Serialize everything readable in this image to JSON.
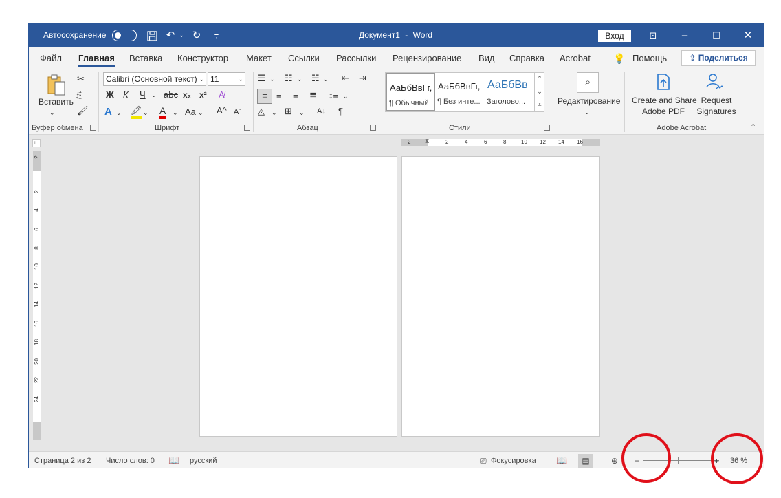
{
  "titlebar": {
    "autosave_label": "Автосохранение",
    "doc_title": "Документ1",
    "separator": "-",
    "app_name": "Word",
    "signin_label": "Вход"
  },
  "tabs": [
    {
      "label": "Файл"
    },
    {
      "label": "Главная"
    },
    {
      "label": "Вставка"
    },
    {
      "label": "Конструктор"
    },
    {
      "label": "Макет"
    },
    {
      "label": "Ссылки"
    },
    {
      "label": "Рассылки"
    },
    {
      "label": "Рецензирование"
    },
    {
      "label": "Вид"
    },
    {
      "label": "Справка"
    },
    {
      "label": "Acrobat"
    }
  ],
  "tell_me_label": "Помощь",
  "share_label": "Поделиться",
  "ribbon": {
    "clipboard": {
      "paste_label": "Вставить",
      "group_label": "Буфер обмена"
    },
    "font": {
      "font_name": "Calibri (Основной текст)",
      "font_size": "11",
      "bold": "Ж",
      "italic": "К",
      "underline": "Ч",
      "strike": "abc",
      "subscript": "x₂",
      "superscript": "x²",
      "font_color_letter": "A",
      "change_case": "Aa",
      "grow": "A^",
      "shrink": "Aˇ",
      "group_label": "Шрифт"
    },
    "paragraph": {
      "group_label": "Абзац",
      "pilcrow": "¶"
    },
    "styles": {
      "items": [
        {
          "preview": "АаБбВвГг,",
          "name": "¶ Обычный"
        },
        {
          "preview": "АаБбВвГг,",
          "name": "¶ Без инте..."
        },
        {
          "preview": "АаБбВв",
          "name": "Заголово..."
        }
      ],
      "group_label": "Стили"
    },
    "editing": {
      "label": "Редактирование"
    },
    "acrobat": {
      "create_line1": "Create and Share",
      "create_line2": "Adobe PDF",
      "request_line1": "Request",
      "request_line2": "Signatures",
      "group_label": "Adobe Acrobat"
    }
  },
  "ruler": {
    "h_ticks": [
      "2",
      "2",
      "4",
      "6",
      "8",
      "10",
      "12",
      "14",
      "16"
    ],
    "v_ticks": [
      "2",
      "2",
      "4",
      "6",
      "8",
      "10",
      "12",
      "14",
      "16",
      "18",
      "20",
      "22",
      "24"
    ]
  },
  "status": {
    "page_info": "Страница 2 из 2",
    "word_count": "Число слов: 0",
    "language": "русский",
    "focus_label": "Фокусировка",
    "zoom_minus": "−",
    "zoom_plus": "+",
    "zoom_percent": "36 %"
  },
  "colors": {
    "word_blue": "#2b579a",
    "highlight_red": "#e0101a"
  }
}
